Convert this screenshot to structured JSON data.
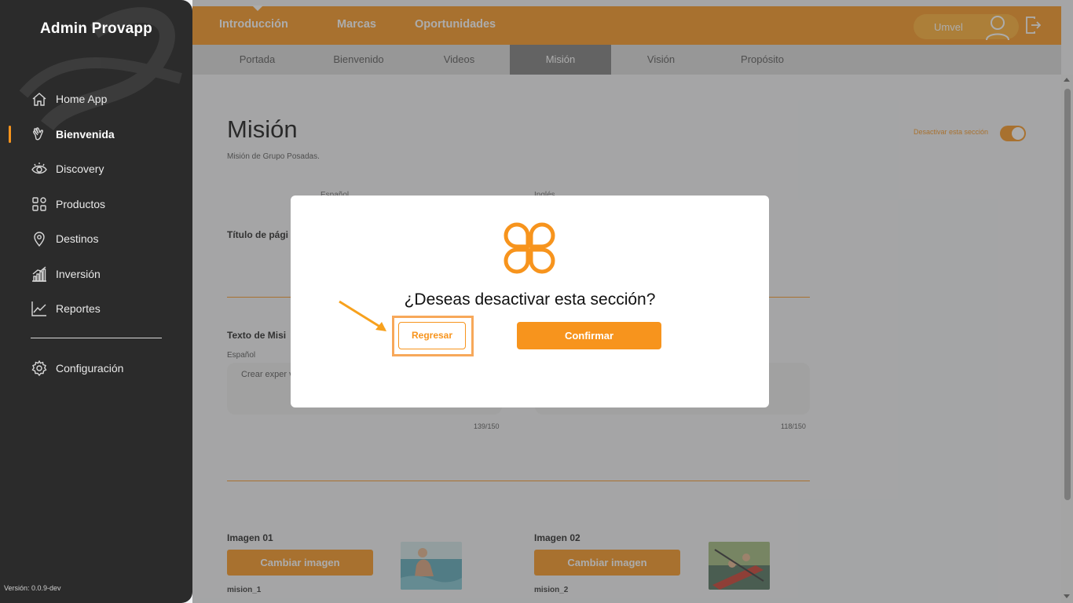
{
  "sidebar": {
    "brand": "Admin Provapp",
    "items": [
      {
        "label": "Home App",
        "icon": "home-icon"
      },
      {
        "label": "Bienvenida",
        "icon": "waving-hand-icon"
      },
      {
        "label": "Discovery",
        "icon": "eye-icon"
      },
      {
        "label": "Productos",
        "icon": "grid-icon"
      },
      {
        "label": "Destinos",
        "icon": "location-pin-icon"
      },
      {
        "label": "Inversión",
        "icon": "bar-chart-icon"
      },
      {
        "label": "Reportes",
        "icon": "line-chart-icon"
      }
    ],
    "active": "Bienvenida",
    "config_label": "Configuración",
    "version": "Versión: 0.0.9-dev"
  },
  "topbar": {
    "tabs": [
      "Introducción",
      "Marcas",
      "Oportunidades"
    ],
    "user_name": "Umvel"
  },
  "subnav": {
    "tabs": [
      "Portada",
      "Bienvenido",
      "Videos",
      "Misión",
      "Visión",
      "Propósito"
    ],
    "active": "Misión"
  },
  "main": {
    "title": "Misión",
    "subtitle": "Misión de Grupo Posadas.",
    "toggle_label": "Desactivar esta sección",
    "lang_es": "Español",
    "lang_en": "Inglés",
    "page_title_label": "Título de pági",
    "mission_text_label": "Texto de Misi",
    "lang_small": "Español",
    "textarea_es": "Crear exper vacacionale de nuestros",
    "counter_es": "139/150",
    "counter_en": "118/150",
    "image1_label": "Imagen 01",
    "image2_label": "Imagen 02",
    "change_image": "Cambiar imagen",
    "image1_name": "mision_1",
    "image2_name": "mision_2"
  },
  "modal": {
    "title": "¿Deseas desactivar esta sección?",
    "back_label": "Regresar",
    "confirm_label": "Confirmar"
  },
  "colors": {
    "accent": "#f7941d",
    "sidebar": "#2b2b2b"
  }
}
